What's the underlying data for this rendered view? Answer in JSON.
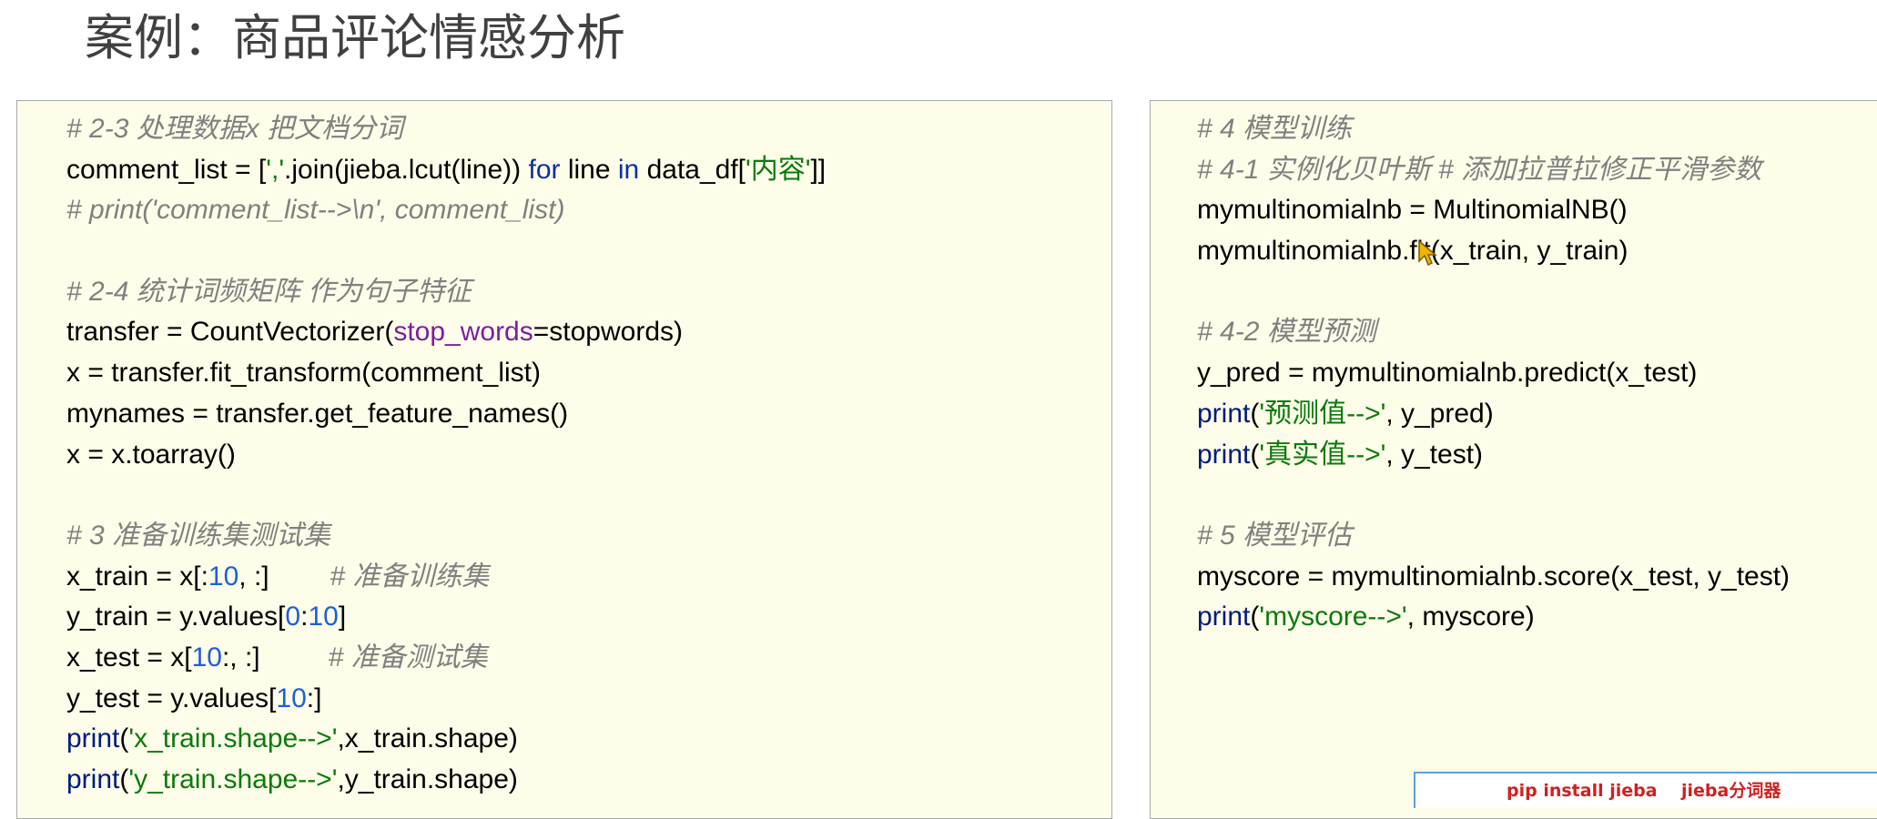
{
  "title": "案例：商品评论情感分析",
  "left_code": {
    "c_2_3": "# 2-3 处理数据x 把文档分词",
    "l1_a": "comment_list = [",
    "l1_str1": "','",
    "l1_b": ".join(jieba.lcut(line)) ",
    "l1_for": "for",
    "l1_c": " line ",
    "l1_in": "in",
    "l1_d": " data_df[",
    "l1_str2": "'内容'",
    "l1_e": "]]",
    "c_print_comment": "# print('comment_list-->\\n', comment_list)",
    "c_2_4": "# 2-4 统计词频矩阵 作为句子特征",
    "l2_a": "transfer = CountVectorizer(",
    "l2_param": "stop_words",
    "l2_b": "=stopwords)",
    "l3": "x = transfer.fit_transform(comment_list)",
    "l4": "mynames = transfer.get_feature_names()",
    "l5": "x = x.toarray()",
    "c_3": "# 3 准备训练集测试集",
    "l6_a": "x_train = x[:",
    "l6_num": "10",
    "l6_b": ", :]",
    "l6_comment": "# 准备训练集",
    "l7_a": "y_train = y.values[",
    "l7_n1": "0",
    "l7_b": ":",
    "l7_n2": "10",
    "l7_c": "]",
    "l8_a": "x_test = x[",
    "l8_num": "10",
    "l8_b": ":, :]",
    "l8_comment": "# 准备测试集",
    "l9_a": "y_test = y.values[",
    "l9_num": "10",
    "l9_b": ":]",
    "l10_print": "print",
    "l10_a": "(",
    "l10_str": "'x_train.shape-->'",
    "l10_b": ",x_train.shape)",
    "l11_print": "print",
    "l11_a": "(",
    "l11_str": "'y_train.shape-->'",
    "l11_b": ",y_train.shape)"
  },
  "right_code": {
    "c_4": "# 4 模型训练",
    "c_4_1": "# 4-1 实例化贝叶斯 # 添加拉普拉修正平滑参数",
    "r1": "mymultinomialnb = MultinomialNB()",
    "r2": "mymultinomialnb.fit(x_train, y_train)",
    "c_4_2": "# 4-2 模型预测",
    "r3": "y_pred = mymultinomialnb.predict(x_test)",
    "r4_print": "print",
    "r4_a": "(",
    "r4_str": "'预测值-->'",
    "r4_b": ", y_pred)",
    "r5_print": "print",
    "r5_a": "(",
    "r5_str": "'真实值-->'",
    "r5_b": ", y_test)",
    "c_5": "# 5 模型评估",
    "r6": "myscore = mymultinomialnb.score(x_test, y_test)",
    "r7_print": "print",
    "r7_a": "(",
    "r7_str": "'myscore-->'",
    "r7_b": ", myscore)"
  },
  "banner": {
    "text": "pip install jieba    jieba分词器"
  },
  "icons": {
    "cursor": "mouse-pointer-icon"
  },
  "colors": {
    "panel_bg": "#fdfde9",
    "comment": "#808080",
    "keyword": "#0b2fa8",
    "string": "#0b7a0b",
    "number": "#1f5fd6",
    "param": "#7a1fa2",
    "banner_text": "#d02020"
  }
}
